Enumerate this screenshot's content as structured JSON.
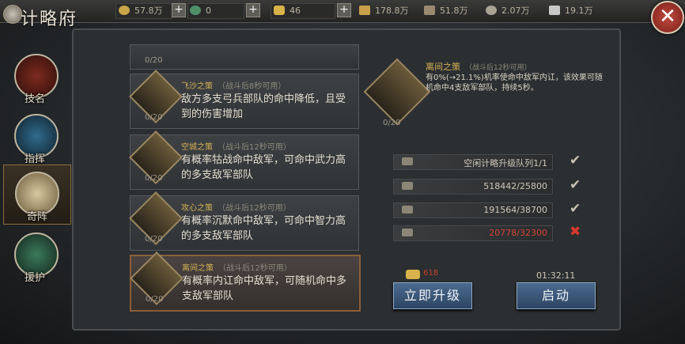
{
  "header": {
    "title": "计略府"
  },
  "resources": [
    {
      "icon": "coin-icon",
      "value": "57.8万"
    },
    {
      "icon": "jade-icon",
      "value": "0"
    },
    {
      "icon": "gold-ingot-icon",
      "value": "46"
    },
    {
      "icon": "grain-icon",
      "value": "178.8万"
    },
    {
      "icon": "wood-icon",
      "value": "51.8万"
    },
    {
      "icon": "stone-icon",
      "value": "2.07万"
    },
    {
      "icon": "iron-icon",
      "value": "19.1万"
    }
  ],
  "nav": [
    {
      "label": "技名",
      "icon": "skill-icon"
    },
    {
      "label": "指挥",
      "icon": "command-icon"
    },
    {
      "label": "奇阵",
      "icon": "formation-icon"
    },
    {
      "label": "援护",
      "icon": "support-icon"
    }
  ],
  "cards": [
    {
      "name": "",
      "sub": "",
      "desc": "",
      "count": "0/20"
    },
    {
      "name": "飞沙之策",
      "sub": "（战斗后8秒可用）",
      "desc": "敌方多支弓兵部队的命中降低，且受到的伤害增加",
      "count": "0/20"
    },
    {
      "name": "空城之策",
      "sub": "（战斗后12秒可用）",
      "desc": "有概率牯战命中敌军，可命中武力高的多支敌军部队",
      "count": "0/20"
    },
    {
      "name": "攻心之策",
      "sub": "（战斗后12秒可用）",
      "desc": "有概率沉默命中敌军，可命中智力高的多支敌军部队",
      "count": "0/20"
    },
    {
      "name": "离间之策",
      "sub": "（战斗后12秒可用）",
      "desc": "有概率内讧命中敌军，可随机命中多支敌军部队",
      "count": "0/20"
    }
  ],
  "detail": {
    "name": "离间之策",
    "sub": "（战斗后12秒可用）",
    "desc": "有0%(→21.1%)机率使命中敌军内讧，该效果可随机命中4支敌军部队，持续5秒。",
    "count": "0/20"
  },
  "requirements": [
    {
      "icon": "hammer-icon",
      "value": "空闲计略升级队列1/1",
      "ok": true
    },
    {
      "icon": "wood-icon",
      "value": "518442/25800",
      "ok": true
    },
    {
      "icon": "stone-icon",
      "value": "191564/38700",
      "ok": true
    },
    {
      "icon": "ore-icon",
      "value": "20778/32300",
      "ok": false
    }
  ],
  "actions": {
    "upgrade_now": "立即升级",
    "start": "启动",
    "cost": "618",
    "timer": "01:32:11"
  }
}
